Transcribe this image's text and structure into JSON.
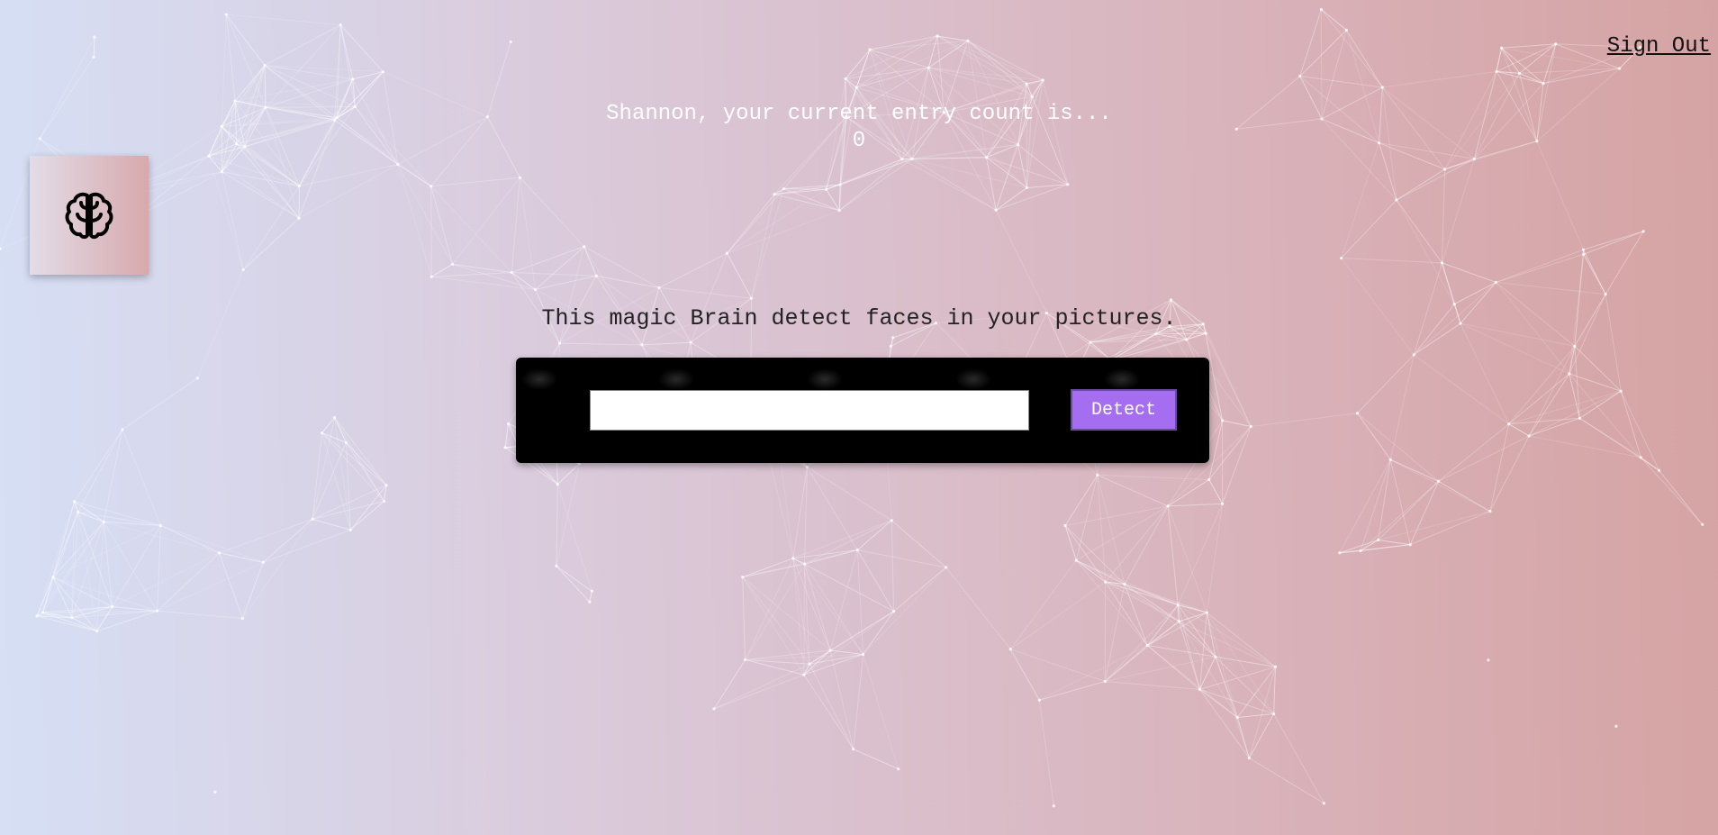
{
  "header": {
    "sign_out_label": "Sign Out"
  },
  "logo": {
    "icon": "brain-icon"
  },
  "rank": {
    "message": "Shannon, your current entry count is...",
    "count": "0"
  },
  "main": {
    "tagline": "This magic Brain detect faces in your pictures.",
    "url_input_value": "",
    "url_input_placeholder": "",
    "detect_label": "Detect"
  },
  "colors": {
    "gradient_start": "#d6dff5",
    "gradient_end": "#d5a3a3",
    "button_accent": "#a56ef0",
    "form_background": "#000000"
  }
}
